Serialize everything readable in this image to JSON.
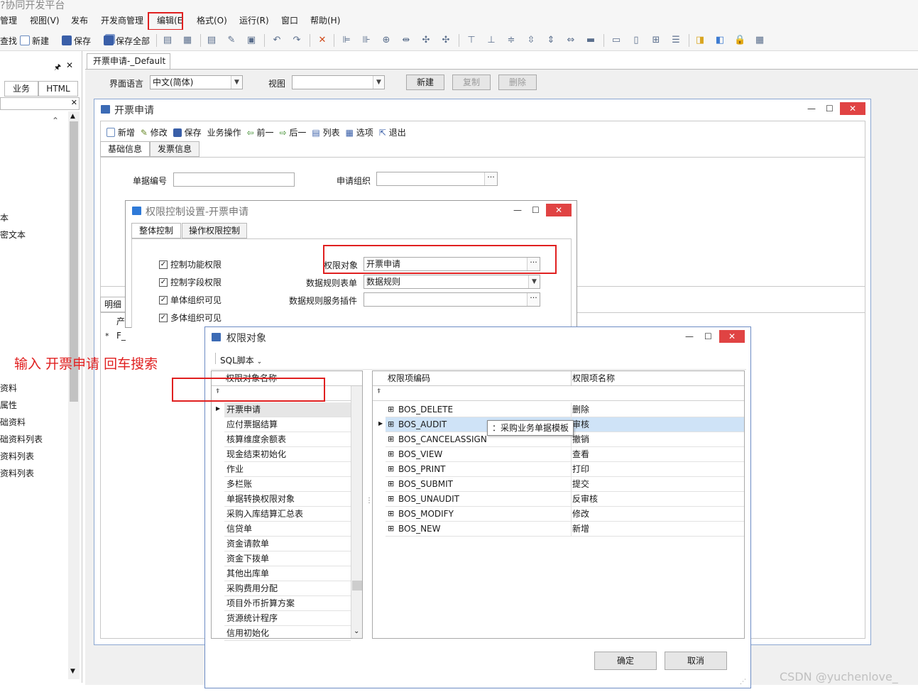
{
  "app": {
    "title": "?协同开发平台"
  },
  "menu": {
    "items": [
      "管理",
      "视图(V)",
      "发布",
      "开发商管理",
      "编辑(E",
      "格式(O)",
      "运行(R)",
      "窗口",
      "帮助(H)"
    ]
  },
  "toolbar": {
    "find": "查找",
    "new": "新建",
    "save": "保存",
    "save_all": "保存全部"
  },
  "left_panel": {
    "tabs": [
      "业务",
      "HTML"
    ],
    "items": [
      "本",
      "密文本",
      "资料",
      "属性",
      "础资料",
      "础资料列表",
      "资料列表",
      "资料列表"
    ]
  },
  "doc_tab": {
    "label": "开票申请-_Default"
  },
  "lang_bar": {
    "language_label": "界面语言",
    "language_value": "中文(简体)",
    "view_label": "视图",
    "view_value": "",
    "new_button": "新建",
    "copy_button": "复制",
    "delete_button": "删除"
  },
  "form_window": {
    "title": "开票申请",
    "toolbar": [
      "新增",
      "修改",
      "保存",
      "业务操作",
      "前一",
      "后一",
      "列表",
      "选项",
      "退出"
    ],
    "tabs": [
      "基础信息",
      "发票信息"
    ],
    "bill_no_label": "单据编号",
    "org_label": "申请组织",
    "detail_tab": "明细",
    "grid_col": "产",
    "grid_row": "F_"
  },
  "perm_window": {
    "title": "权限控制设置-开票申请",
    "tabs": [
      "整体控制",
      "操作权限控制"
    ],
    "checkboxes": [
      "控制功能权限",
      "控制字段权限",
      "单体组织可见",
      "多体组织可见"
    ],
    "perm_object_label": "权限对象",
    "perm_object_value": "开票申请",
    "rule_form_label": "数据规则表单",
    "rule_form_value": "数据规则",
    "rule_plugin_label": "数据规则服务插件",
    "rule_plugin_value": ""
  },
  "obj_window": {
    "title": "权限对象",
    "sql_button": "SQL脚本",
    "left_grid_header": "权限对象名称",
    "left_items": [
      "开票申请",
      "应付票据结算",
      "核算维度余额表",
      "现金结束初始化",
      "作业",
      "多栏账",
      "单据转换权限对象",
      "采购入库结算汇总表",
      "信贷单",
      "资金请款单",
      "资金下拨单",
      "其他出库单",
      "采购费用分配",
      "项目外币折算方案",
      "货源统计程序",
      "信用初始化"
    ],
    "right_headers": [
      "权限项编码",
      "权限项名称"
    ],
    "right_rows": [
      {
        "code": "BOS_DELETE",
        "name": "删除"
      },
      {
        "code": "BOS_AUDIT",
        "name": "审核"
      },
      {
        "code": "BOS_CANCELASSIGN",
        "name": "撤销"
      },
      {
        "code": "BOS_VIEW",
        "name": "查看"
      },
      {
        "code": "BOS_PRINT",
        "name": "打印"
      },
      {
        "code": "BOS_SUBMIT",
        "name": "提交"
      },
      {
        "code": "BOS_UNAUDIT",
        "name": "反审核"
      },
      {
        "code": "BOS_MODIFY",
        "name": "修改"
      },
      {
        "code": "BOS_NEW",
        "name": "新增"
      }
    ],
    "tooltip": "：采购业务单据模板",
    "ok_button": "确定",
    "cancel_button": "取消"
  },
  "annotation": "输入 开票申请  回车搜索",
  "watermark": "CSDN @yuchenlove_"
}
